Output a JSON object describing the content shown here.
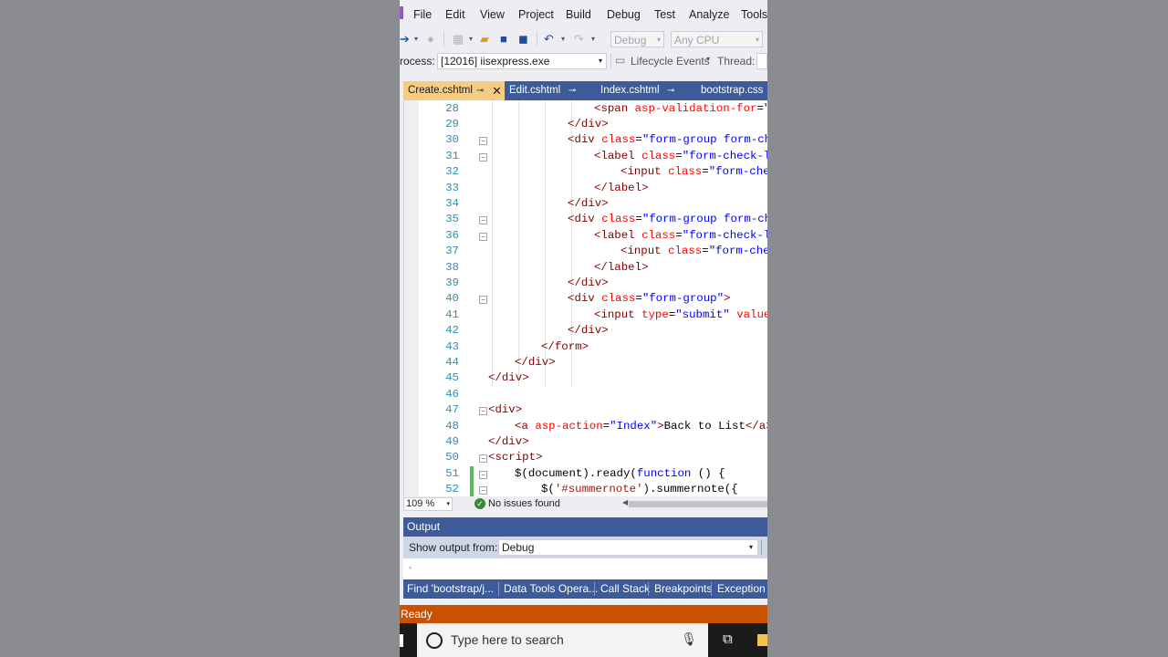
{
  "menu": [
    "File",
    "Edit",
    "View",
    "Project",
    "Build",
    "Debug",
    "Test",
    "Analyze",
    "Tools"
  ],
  "toolbar": {
    "config": "Debug",
    "platform": "Any CPU"
  },
  "process": {
    "label": "rocess:",
    "value": "[12016] iisexpress.exe",
    "lifecycle": "Lifecycle Events",
    "thread_label": "Thread:"
  },
  "tabs": [
    {
      "label": "Create.cshtml",
      "active": true
    },
    {
      "label": "Edit.cshtml",
      "active": false
    },
    {
      "label": "Index.cshtml",
      "active": false
    },
    {
      "label": "bootstrap.css",
      "active": false
    }
  ],
  "editor": {
    "lines": [
      {
        "n": "28",
        "indent": 4,
        "tokens": [
          [
            "tag",
            "<"
          ],
          [
            "tag",
            "span"
          ],
          [
            "txt",
            " "
          ],
          [
            "attr",
            "asp-validation-for"
          ],
          [
            "txt",
            "="
          ],
          [
            "val",
            "\""
          ]
        ]
      },
      {
        "n": "29",
        "indent": 3,
        "tokens": [
          [
            "tag",
            "</"
          ],
          [
            "tag",
            "div"
          ],
          [
            "tag",
            ">"
          ]
        ]
      },
      {
        "n": "30",
        "indent": 3,
        "fold": true,
        "tokens": [
          [
            "tag",
            "<"
          ],
          [
            "tag",
            "div"
          ],
          [
            "txt",
            " "
          ],
          [
            "attr",
            "class"
          ],
          [
            "txt",
            "="
          ],
          [
            "val",
            "\"form-group form-ch"
          ]
        ]
      },
      {
        "n": "31",
        "indent": 4,
        "fold": true,
        "tokens": [
          [
            "tag",
            "<"
          ],
          [
            "tag",
            "label"
          ],
          [
            "txt",
            " "
          ],
          [
            "attr",
            "class"
          ],
          [
            "txt",
            "="
          ],
          [
            "val",
            "\"form-check-l"
          ]
        ]
      },
      {
        "n": "32",
        "indent": 5,
        "tokens": [
          [
            "tag",
            "<"
          ],
          [
            "tag",
            "input"
          ],
          [
            "txt",
            " "
          ],
          [
            "attr",
            "class"
          ],
          [
            "txt",
            "="
          ],
          [
            "val",
            "\"form-che"
          ]
        ]
      },
      {
        "n": "33",
        "indent": 4,
        "tokens": [
          [
            "tag",
            "</"
          ],
          [
            "tag",
            "label"
          ],
          [
            "tag",
            ">"
          ]
        ]
      },
      {
        "n": "34",
        "indent": 3,
        "tokens": [
          [
            "tag",
            "</"
          ],
          [
            "tag",
            "div"
          ],
          [
            "tag",
            ">"
          ]
        ]
      },
      {
        "n": "35",
        "indent": 3,
        "fold": true,
        "tokens": [
          [
            "tag",
            "<"
          ],
          [
            "tag",
            "div"
          ],
          [
            "txt",
            " "
          ],
          [
            "attr",
            "class"
          ],
          [
            "txt",
            "="
          ],
          [
            "val",
            "\"form-group form-ch"
          ]
        ]
      },
      {
        "n": "36",
        "indent": 4,
        "fold": true,
        "tokens": [
          [
            "tag",
            "<"
          ],
          [
            "tag",
            "label"
          ],
          [
            "txt",
            " "
          ],
          [
            "attr",
            "class"
          ],
          [
            "txt",
            "="
          ],
          [
            "val",
            "\"form-check-l"
          ]
        ]
      },
      {
        "n": "37",
        "indent": 5,
        "tokens": [
          [
            "tag",
            "<"
          ],
          [
            "tag",
            "input"
          ],
          [
            "txt",
            " "
          ],
          [
            "attr",
            "class"
          ],
          [
            "txt",
            "="
          ],
          [
            "val",
            "\"form-che"
          ]
        ]
      },
      {
        "n": "38",
        "indent": 4,
        "tokens": [
          [
            "tag",
            "</"
          ],
          [
            "tag",
            "label"
          ],
          [
            "tag",
            ">"
          ]
        ]
      },
      {
        "n": "39",
        "indent": 3,
        "tokens": [
          [
            "tag",
            "</"
          ],
          [
            "tag",
            "div"
          ],
          [
            "tag",
            ">"
          ]
        ]
      },
      {
        "n": "40",
        "indent": 3,
        "fold": true,
        "tokens": [
          [
            "tag",
            "<"
          ],
          [
            "tag",
            "div"
          ],
          [
            "txt",
            " "
          ],
          [
            "attr",
            "class"
          ],
          [
            "txt",
            "="
          ],
          [
            "val",
            "\"form-group\""
          ],
          [
            "tag",
            ">"
          ]
        ]
      },
      {
        "n": "41",
        "indent": 4,
        "tokens": [
          [
            "tag",
            "<"
          ],
          [
            "tag",
            "input"
          ],
          [
            "txt",
            " "
          ],
          [
            "attr",
            "type"
          ],
          [
            "txt",
            "="
          ],
          [
            "val",
            "\"submit\""
          ],
          [
            "txt",
            " "
          ],
          [
            "attr",
            "value"
          ]
        ]
      },
      {
        "n": "42",
        "indent": 3,
        "tokens": [
          [
            "tag",
            "</"
          ],
          [
            "tag",
            "div"
          ],
          [
            "tag",
            ">"
          ]
        ]
      },
      {
        "n": "43",
        "indent": 2,
        "tokens": [
          [
            "tag",
            "</"
          ],
          [
            "tag",
            "form"
          ],
          [
            "tag",
            ">"
          ]
        ]
      },
      {
        "n": "44",
        "indent": 1,
        "tokens": [
          [
            "tag",
            "</"
          ],
          [
            "tag",
            "div"
          ],
          [
            "tag",
            ">"
          ]
        ]
      },
      {
        "n": "45",
        "indent": 0,
        "tokens": [
          [
            "tag",
            "</"
          ],
          [
            "tag",
            "div"
          ],
          [
            "tag",
            ">"
          ]
        ]
      },
      {
        "n": "46",
        "indent": 0,
        "tokens": []
      },
      {
        "n": "47",
        "indent": 0,
        "fold": true,
        "tokens": [
          [
            "tag",
            "<"
          ],
          [
            "tag",
            "div"
          ],
          [
            "tag",
            ">"
          ]
        ]
      },
      {
        "n": "48",
        "indent": 1,
        "tokens": [
          [
            "tag",
            "<"
          ],
          [
            "tag",
            "a"
          ],
          [
            "txt",
            " "
          ],
          [
            "attr",
            "asp-action"
          ],
          [
            "txt",
            "="
          ],
          [
            "val",
            "\"Index\""
          ],
          [
            "tag",
            ">"
          ],
          [
            "txt",
            "Back to List"
          ],
          [
            "tag",
            "</"
          ],
          [
            "tag",
            "a"
          ],
          [
            "tag",
            ">"
          ]
        ]
      },
      {
        "n": "49",
        "indent": 0,
        "tokens": [
          [
            "tag",
            "</"
          ],
          [
            "tag",
            "div"
          ],
          [
            "tag",
            ">"
          ]
        ]
      },
      {
        "n": "50",
        "indent": 0,
        "fold": true,
        "tokens": [
          [
            "tag",
            "<"
          ],
          [
            "tag",
            "script"
          ],
          [
            "tag",
            ">"
          ]
        ]
      },
      {
        "n": "51",
        "indent": 1,
        "fold": true,
        "change": true,
        "tokens": [
          [
            "txt",
            "$(document).ready("
          ],
          [
            "kw",
            "function"
          ],
          [
            "txt",
            " () {"
          ]
        ]
      },
      {
        "n": "52",
        "indent": 2,
        "fold": true,
        "change": true,
        "tokens": [
          [
            "txt",
            "$("
          ],
          [
            "str",
            "'#summernote'"
          ],
          [
            "txt",
            ").summernote({"
          ]
        ]
      }
    ]
  },
  "editor_status": {
    "zoom": "109 %",
    "issues": "No issues found"
  },
  "output": {
    "title": "Output",
    "show_from_label": "Show output from:",
    "source": "Debug"
  },
  "bottom_tabs": [
    "Find 'bootstrap/j...",
    "Data Tools Opera...",
    "Call Stack",
    "Breakpoints",
    "Exception S"
  ],
  "status": "Ready",
  "taskbar": {
    "search_placeholder": "Type here to search"
  },
  "colors": {
    "accent_blue": "#3d5a99",
    "status_orange": "#ca5100",
    "active_tab": "#f5cc84"
  }
}
